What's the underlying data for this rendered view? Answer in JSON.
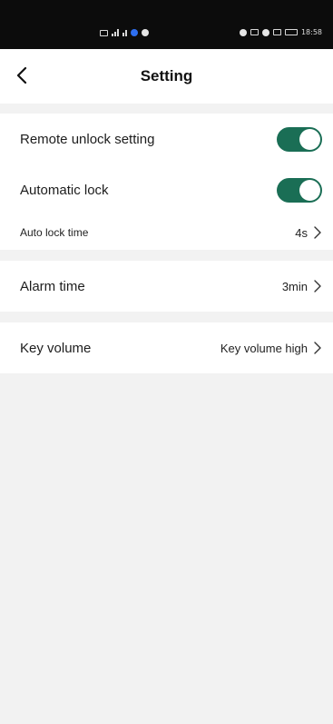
{
  "status_bar": {
    "time": "18:58"
  },
  "header": {
    "title": "Setting"
  },
  "settings": {
    "remote_unlock": {
      "label": "Remote unlock setting",
      "enabled": true
    },
    "automatic_lock": {
      "label": "Automatic lock",
      "enabled": true
    },
    "auto_lock_time": {
      "label": "Auto lock time",
      "value": "4s"
    },
    "alarm_time": {
      "label": "Alarm time",
      "value": "3min"
    },
    "key_volume": {
      "label": "Key volume",
      "value": "Key volume high"
    }
  },
  "colors": {
    "toggle_on": "#1a6e55",
    "status_bar": "#0c0c0c",
    "section_gap": "#f2f2f2"
  },
  "icons": {
    "back": "chevron-left-icon",
    "row_arrow": "chevron-right-icon"
  }
}
